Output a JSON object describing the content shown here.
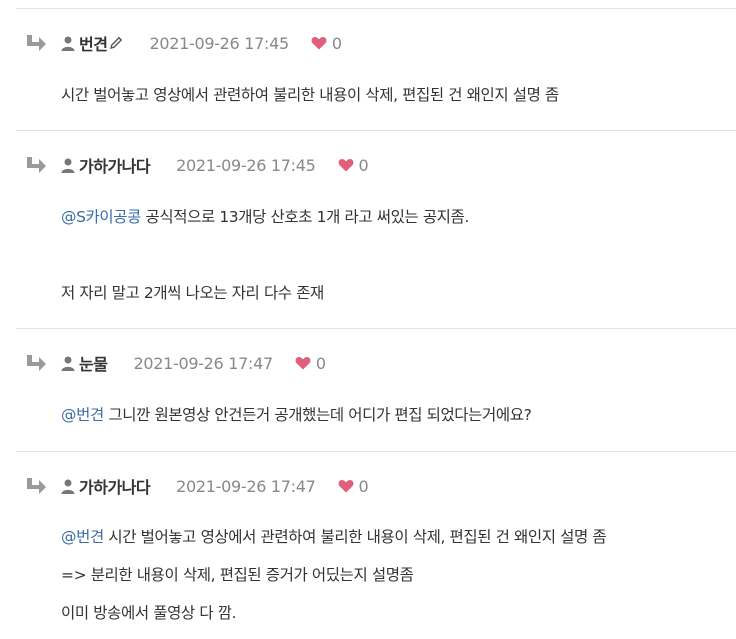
{
  "comments": [
    {
      "author": "번견",
      "date": "2021-09-26 17:45",
      "likes": "0",
      "lines": [
        {
          "text": "시간 벌어놓고 영상에서 관련하여 불리한 내용이 삭제, 편집된 건 왜인지 설명 좀"
        }
      ]
    },
    {
      "author": "가하가나다",
      "date": "2021-09-26 17:45",
      "likes": "0",
      "lines": [
        {
          "mention": "@S카이공콩",
          "text": " 공식적으로 13개당 산호초 1개 라고 써있는 공지좀."
        },
        {
          "text": "저 자리 말고 2개씩 나오는 자리 다수 존재"
        }
      ]
    },
    {
      "author": "눈물",
      "date": "2021-09-26 17:47",
      "likes": "0",
      "lines": [
        {
          "mention": "@번견",
          "text": " 그니깐 원본영상 안건든거 공개했는데 어디가 편집 되었다는거에요?"
        }
      ]
    },
    {
      "author": "가하가나다",
      "date": "2021-09-26 17:47",
      "likes": "0",
      "lines": [
        {
          "mention": "@번견",
          "text": " 시간 벌어놓고 영상에서 관련하여 불리한 내용이 삭제, 편집된 건 왜인지 설명 좀"
        },
        {
          "text": "=> 분리한 내용이 삭제, 편집된 증거가 어딨는지 설명좀"
        },
        {
          "text": "이미 방송에서 풀영상 다 깜."
        }
      ]
    }
  ],
  "colors": {
    "mention": "#3a6ea5",
    "heart": "#e0607a",
    "date": "#888888",
    "divider": "#e2e2e2"
  },
  "icons": {
    "reply": "reply-arrow-icon",
    "user": "user-icon",
    "edit": "pencil-icon",
    "like": "heart-icon"
  }
}
